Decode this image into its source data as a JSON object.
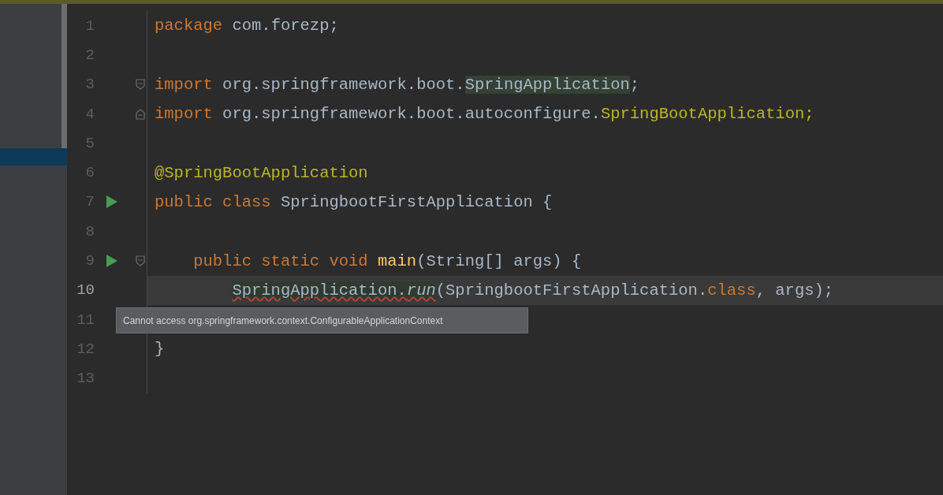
{
  "editor": {
    "lines": [
      {
        "number": "1",
        "current": false,
        "run": false,
        "tokens": [
          {
            "text": "package",
            "kind": "keyword"
          },
          {
            "text": " com.forezp;",
            "kind": "plain"
          }
        ]
      },
      {
        "number": "2",
        "current": false,
        "run": false
      },
      {
        "number": "3",
        "current": false,
        "run": false,
        "fold_marker": {
          "kind": "start"
        },
        "tokens": [
          {
            "text": "import",
            "kind": "keyword"
          },
          {
            "text": " org.springframework.boot.",
            "kind": "plain"
          },
          {
            "text": "SpringApplication",
            "kind": "highlighted"
          },
          {
            "text": ";",
            "kind": "plain"
          }
        ]
      },
      {
        "number": "4",
        "current": false,
        "run": false,
        "fold_marker": {
          "kind": "end"
        },
        "tokens": [
          {
            "text": "import",
            "kind": "keyword"
          },
          {
            "text": " org.springframework.boot.autoconfigure.",
            "kind": "plain"
          },
          {
            "text": "SpringBootApplication;",
            "kind": "annotation"
          }
        ]
      },
      {
        "number": "5",
        "current": false,
        "run": false
      },
      {
        "number": "6",
        "current": false,
        "run": false,
        "tokens": [
          {
            "text": "@SpringBootApplication",
            "kind": "annotation"
          }
        ]
      },
      {
        "number": "7",
        "current": false,
        "run": true,
        "tokens": [
          {
            "text": "public class",
            "kind": "keyword"
          },
          {
            "text": " SpringbootFirstApplication {",
            "kind": "plain"
          }
        ],
        "children": [
          {
            "number": "8",
            "current": false,
            "run": false
          },
          {
            "number": "9",
            "current": false,
            "run": true,
            "fold_marker": {
              "kind": "start"
            },
            "tokens": [
              {
                "text": "public static void",
                "kind": "keyword"
              },
              {
                "text": " main",
                "kind": "method"
              },
              {
                "text": "(String[] args) {",
                "kind": "plain"
              }
            ],
            "children": [
              {
                "number": "10",
                "current": true,
                "run": false,
                "tokens": [
                  {
                    "text": "SpringApplication.",
                    "kind": "error"
                  },
                  {
                    "text": "run",
                    "kind": "error-static"
                  },
                  {
                    "text": "(SpringbootFirstApplication.",
                    "kind": "plain"
                  },
                  {
                    "text": "class",
                    "kind": "keyword"
                  },
                  {
                    "text": ", args);",
                    "kind": "plain"
                  }
                ]
              },
              {
                "number": "11",
                "current": false,
                "run": false
              }
            ]
          }
        ]
      },
      {
        "number": "12",
        "current": false,
        "run": false,
        "tokens": [
          {
            "text": "}",
            "kind": "plain"
          }
        ]
      },
      {
        "number": "13",
        "current": false,
        "run": false
      }
    ]
  },
  "tooltip": {
    "text": "Cannot access org.springframework.context.ConfigurableApplicationContext"
  }
}
